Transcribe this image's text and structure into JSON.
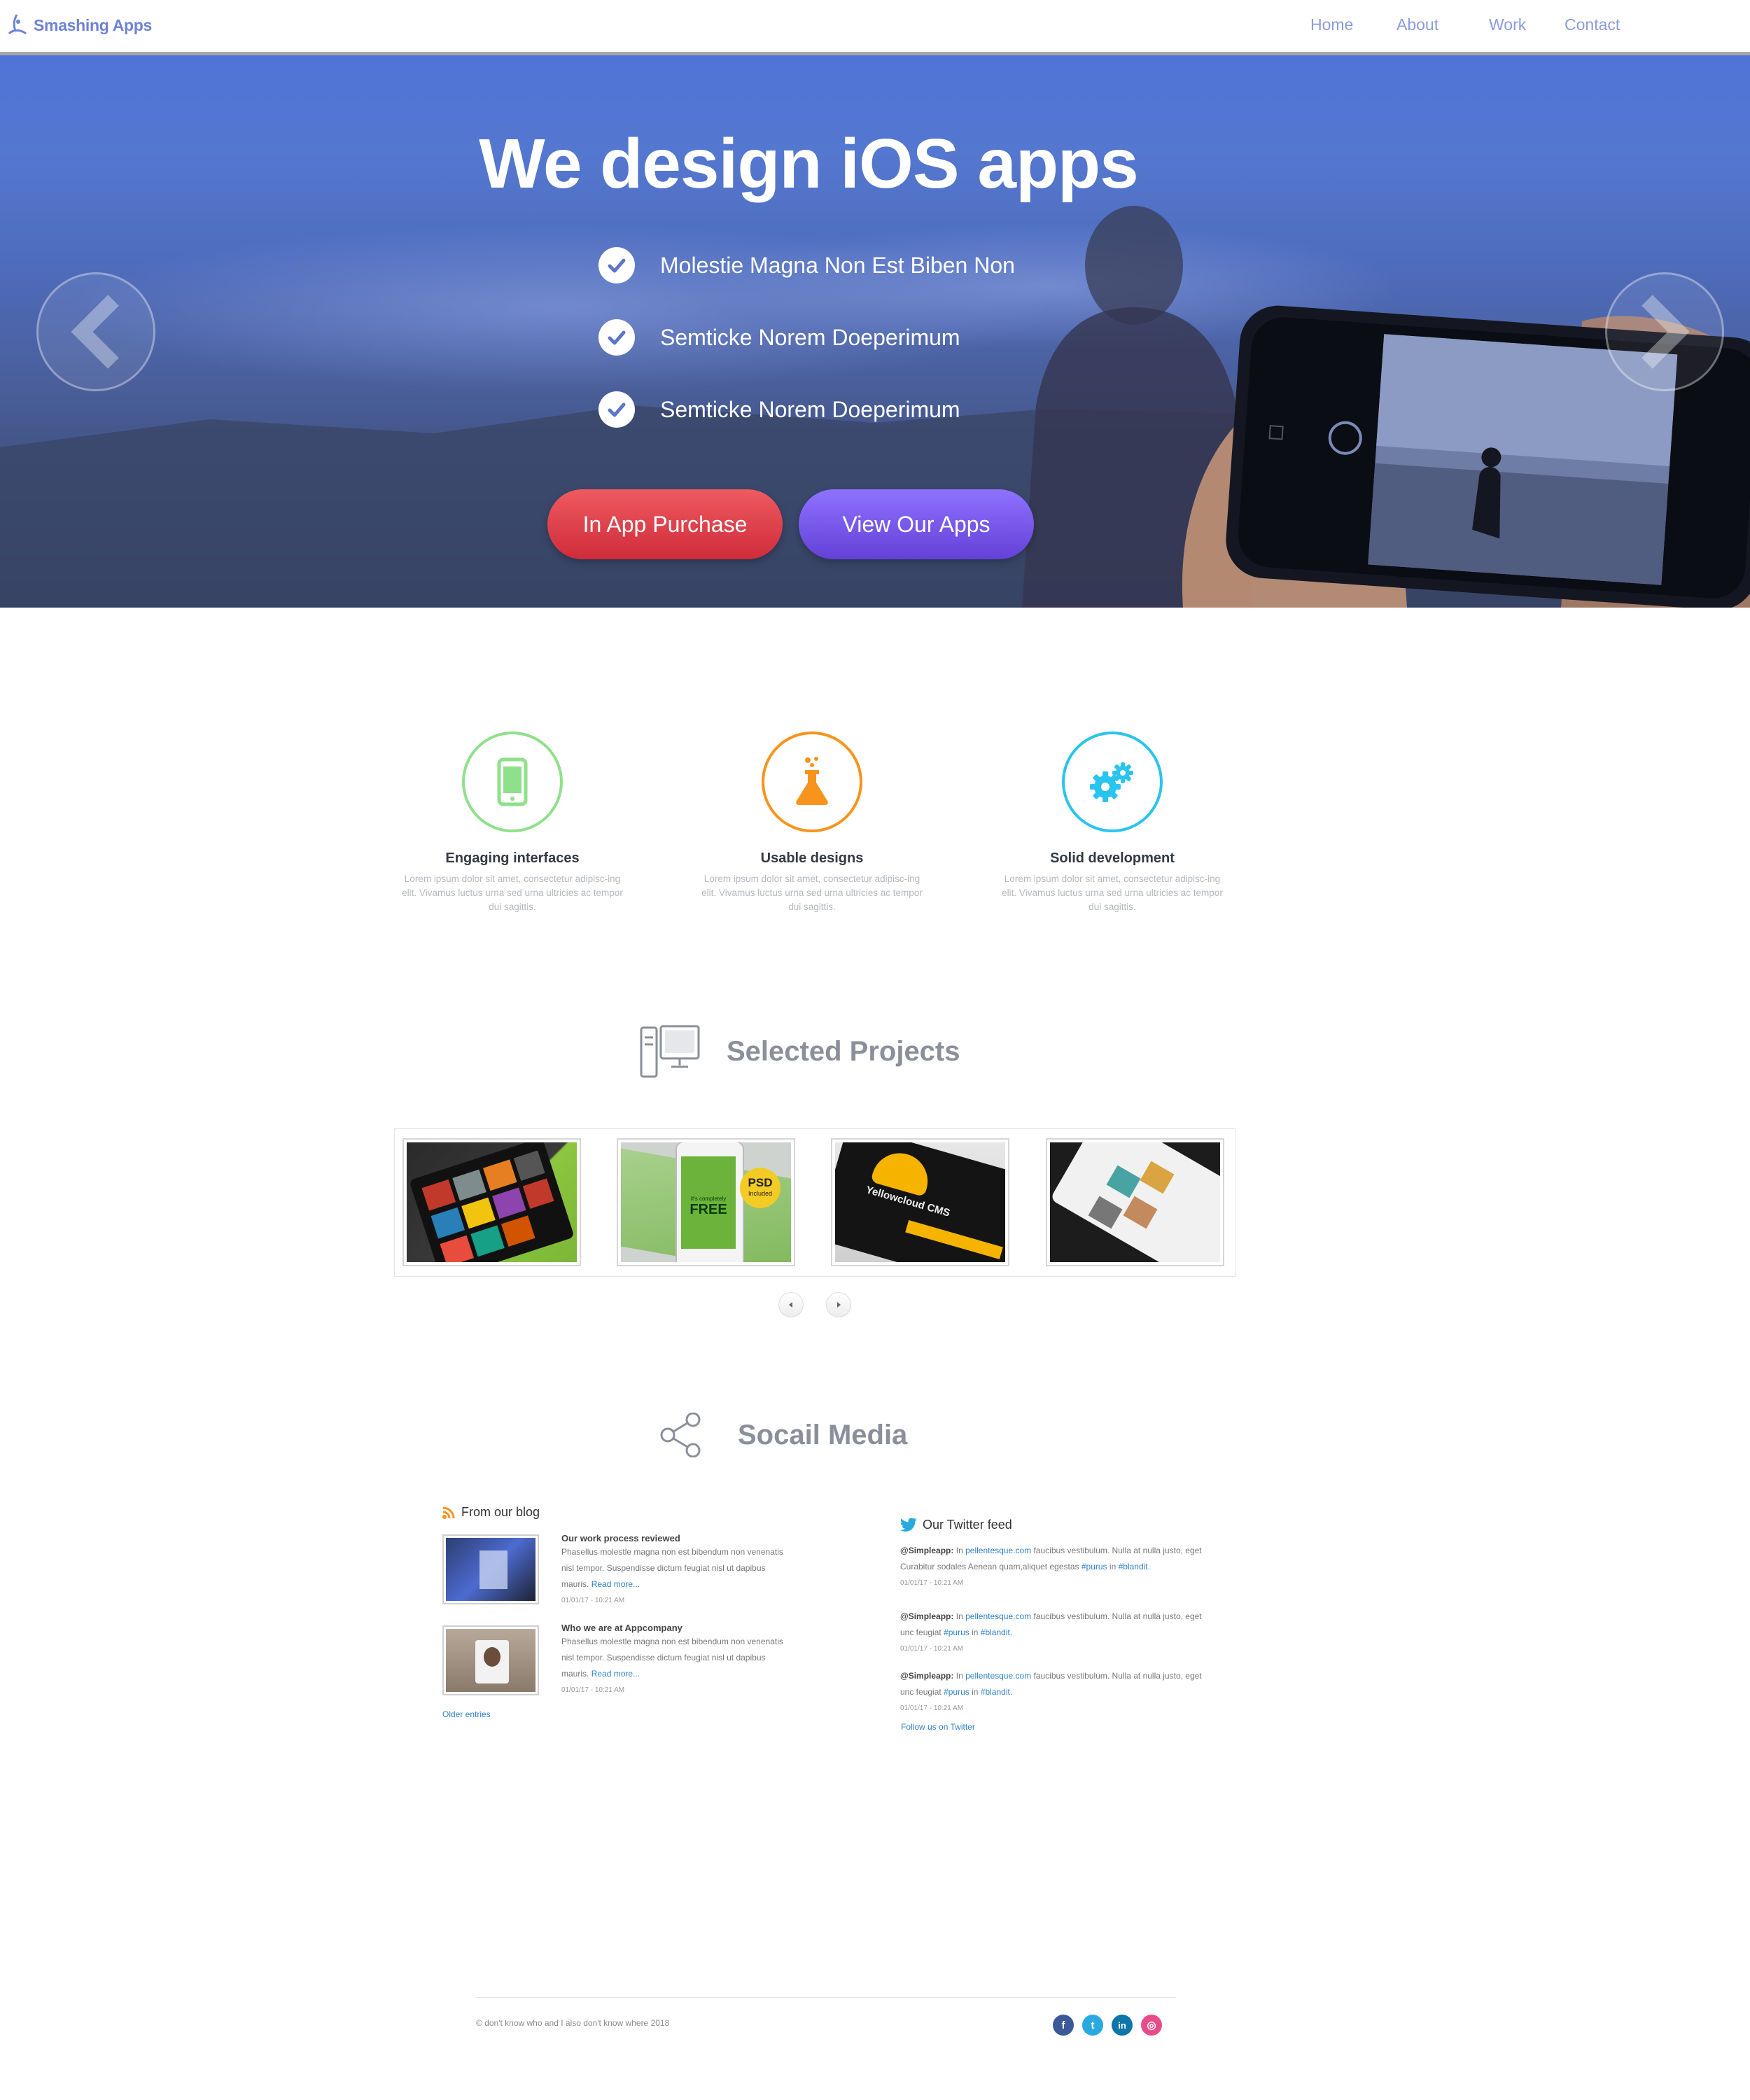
{
  "nav": {
    "brand": "Smashing Apps",
    "links": [
      "Home",
      "About",
      "Work",
      "Contact"
    ]
  },
  "hero": {
    "title": "We design iOS apps",
    "features": [
      "Molestie Magna Non Est Biben Non",
      "Semticke Norem Doeperimum",
      "Semticke Norem Doeperimum"
    ],
    "primary_button": "In App Purchase",
    "secondary_button": "View Our Apps"
  },
  "services": [
    {
      "title": "Engaging interfaces",
      "desc": "Lorem ipsum dolor sit amet, consectetur adipisc-ing elit. Vivamus luctus urna sed urna ultricies ac tempor dui sagittis.",
      "icon": "phone-icon",
      "color": "#8fe08a"
    },
    {
      "title": "Usable designs",
      "desc": "Lorem ipsum dolor sit amet, consectetur adipisc-ing elit. Vivamus luctus urna sed urna ultricies ac tempor dui sagittis.",
      "icon": "flask-icon",
      "color": "#f7941d"
    },
    {
      "title": "Solid development",
      "desc": "Lorem ipsum dolor sit amet, consectetur adipisc-ing elit. Vivamus luctus urna sed urna ultricies ac tempor dui sagittis.",
      "icon": "gears-icon",
      "color": "#29c4ef"
    }
  ],
  "projects": {
    "heading": "Selected Projects",
    "psd_badge": "PSD",
    "psd_sub": "Included",
    "free_label": "FREE",
    "free_sub": "It's completely",
    "cms_label": "Yellowcloud CMS"
  },
  "social": {
    "heading": "Socail Media",
    "blog": {
      "title": "From our blog",
      "posts": [
        {
          "title": "Our work process reviewed",
          "body": "Phasellus molestle magna non est bibendum non venenatis nisl tempor. Suspendisse dictum feugiat nisl ut dapibus mauris.",
          "read_more": "Read more...",
          "date": "01/01/17 - 10:21 AM"
        },
        {
          "title": "Who we are at Appcompany",
          "body": "Phasellus molestle magna non est bibendum non venenatis nisl tempor. Suspendisse dictum feugiat nisl ut dapibus mauris.",
          "read_more": "Read more...",
          "date": "01/01/17 - 10:21 AM"
        }
      ],
      "older": "Older entries"
    },
    "twitter": {
      "title": "Our Twitter feed",
      "tweets": [
        {
          "user": "@Simpleapp:",
          "pre": "In",
          "link": "pellentesque.com",
          "body": "faucibus vestibulum. Nulla at nulla justo, eget Curabitur sodales Aenean quam,aliquet egestas",
          "tag1": "#purus",
          "mid": "in",
          "tag2": "#blandit.",
          "date": "01/01/17 - 10:21 AM"
        },
        {
          "user": "@Simpleapp:",
          "pre": "In",
          "link": "pellentesque.com",
          "body": "faucibus vestibulum. Nulla at nulla justo, eget unc feugiat",
          "tag1": "#purus",
          "mid": "in",
          "tag2": "#blandit.",
          "date": "01/01/17 - 10:21 AM"
        },
        {
          "user": "@Simpleapp:",
          "pre": "In",
          "link": "pellentesque.com",
          "body": "faucibus vestibulum. Nulla at nulla justo, eget unc feugiat",
          "tag1": "#purus",
          "mid": "in",
          "tag2": "#blandit.",
          "date": "01/01/17 - 10:21 AM"
        }
      ],
      "follow": "Follow us on Twitter"
    }
  },
  "footer": {
    "copyright": "© don't know who and I also don't know where 2018",
    "icons": [
      {
        "name": "facebook-icon",
        "glyph": "f",
        "color": "#3b5998"
      },
      {
        "name": "twitter-icon",
        "glyph": "t",
        "color": "#2aa9e0"
      },
      {
        "name": "linkedin-icon",
        "glyph": "in",
        "color": "#0e76a8"
      },
      {
        "name": "dribbble-icon",
        "glyph": "◎",
        "color": "#ea4c89"
      }
    ]
  }
}
